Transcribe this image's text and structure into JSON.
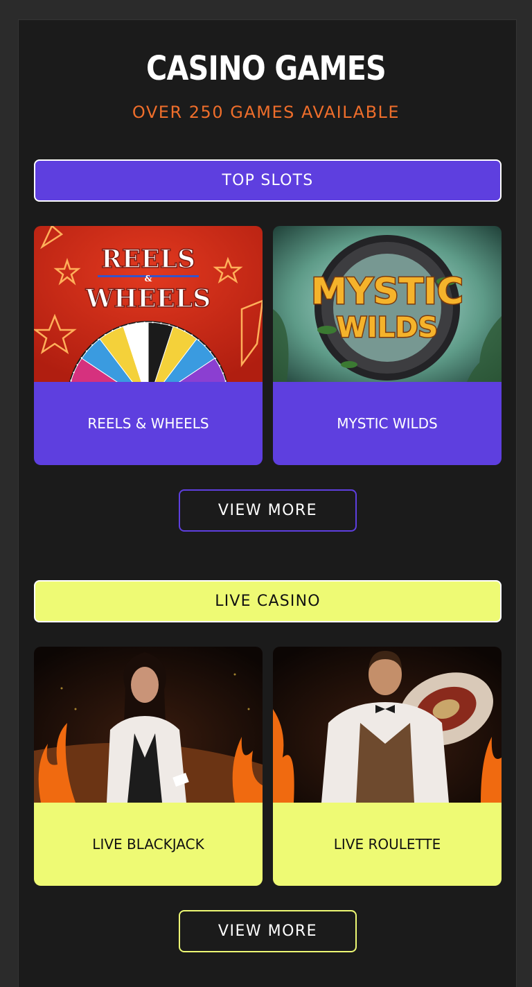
{
  "header": {
    "title": "CASINO GAMES",
    "subtitle": "OVER 250 GAMES AVAILABLE"
  },
  "colors": {
    "accent_purple": "#5e3fdf",
    "accent_yellow": "#eefa74",
    "subtitle_orange": "#ef6e2b",
    "panel_bg": "#1b1b1b"
  },
  "top_slots": {
    "label": "TOP SLOTS",
    "cards": [
      {
        "label": "REELS & WHEELS",
        "art": {
          "line1": "REELS",
          "amp": "&",
          "line2": "WHEELS"
        }
      },
      {
        "label": "MYSTIC WILDS",
        "art": {
          "line1": "MYSTIC",
          "line2": "WILDS"
        }
      }
    ],
    "view_more": "VIEW MORE"
  },
  "live_casino": {
    "label": "LIVE CASINO",
    "cards": [
      {
        "label": "LIVE BLACKJACK"
      },
      {
        "label": "LIVE ROULETTE"
      }
    ],
    "view_more": "VIEW MORE"
  }
}
